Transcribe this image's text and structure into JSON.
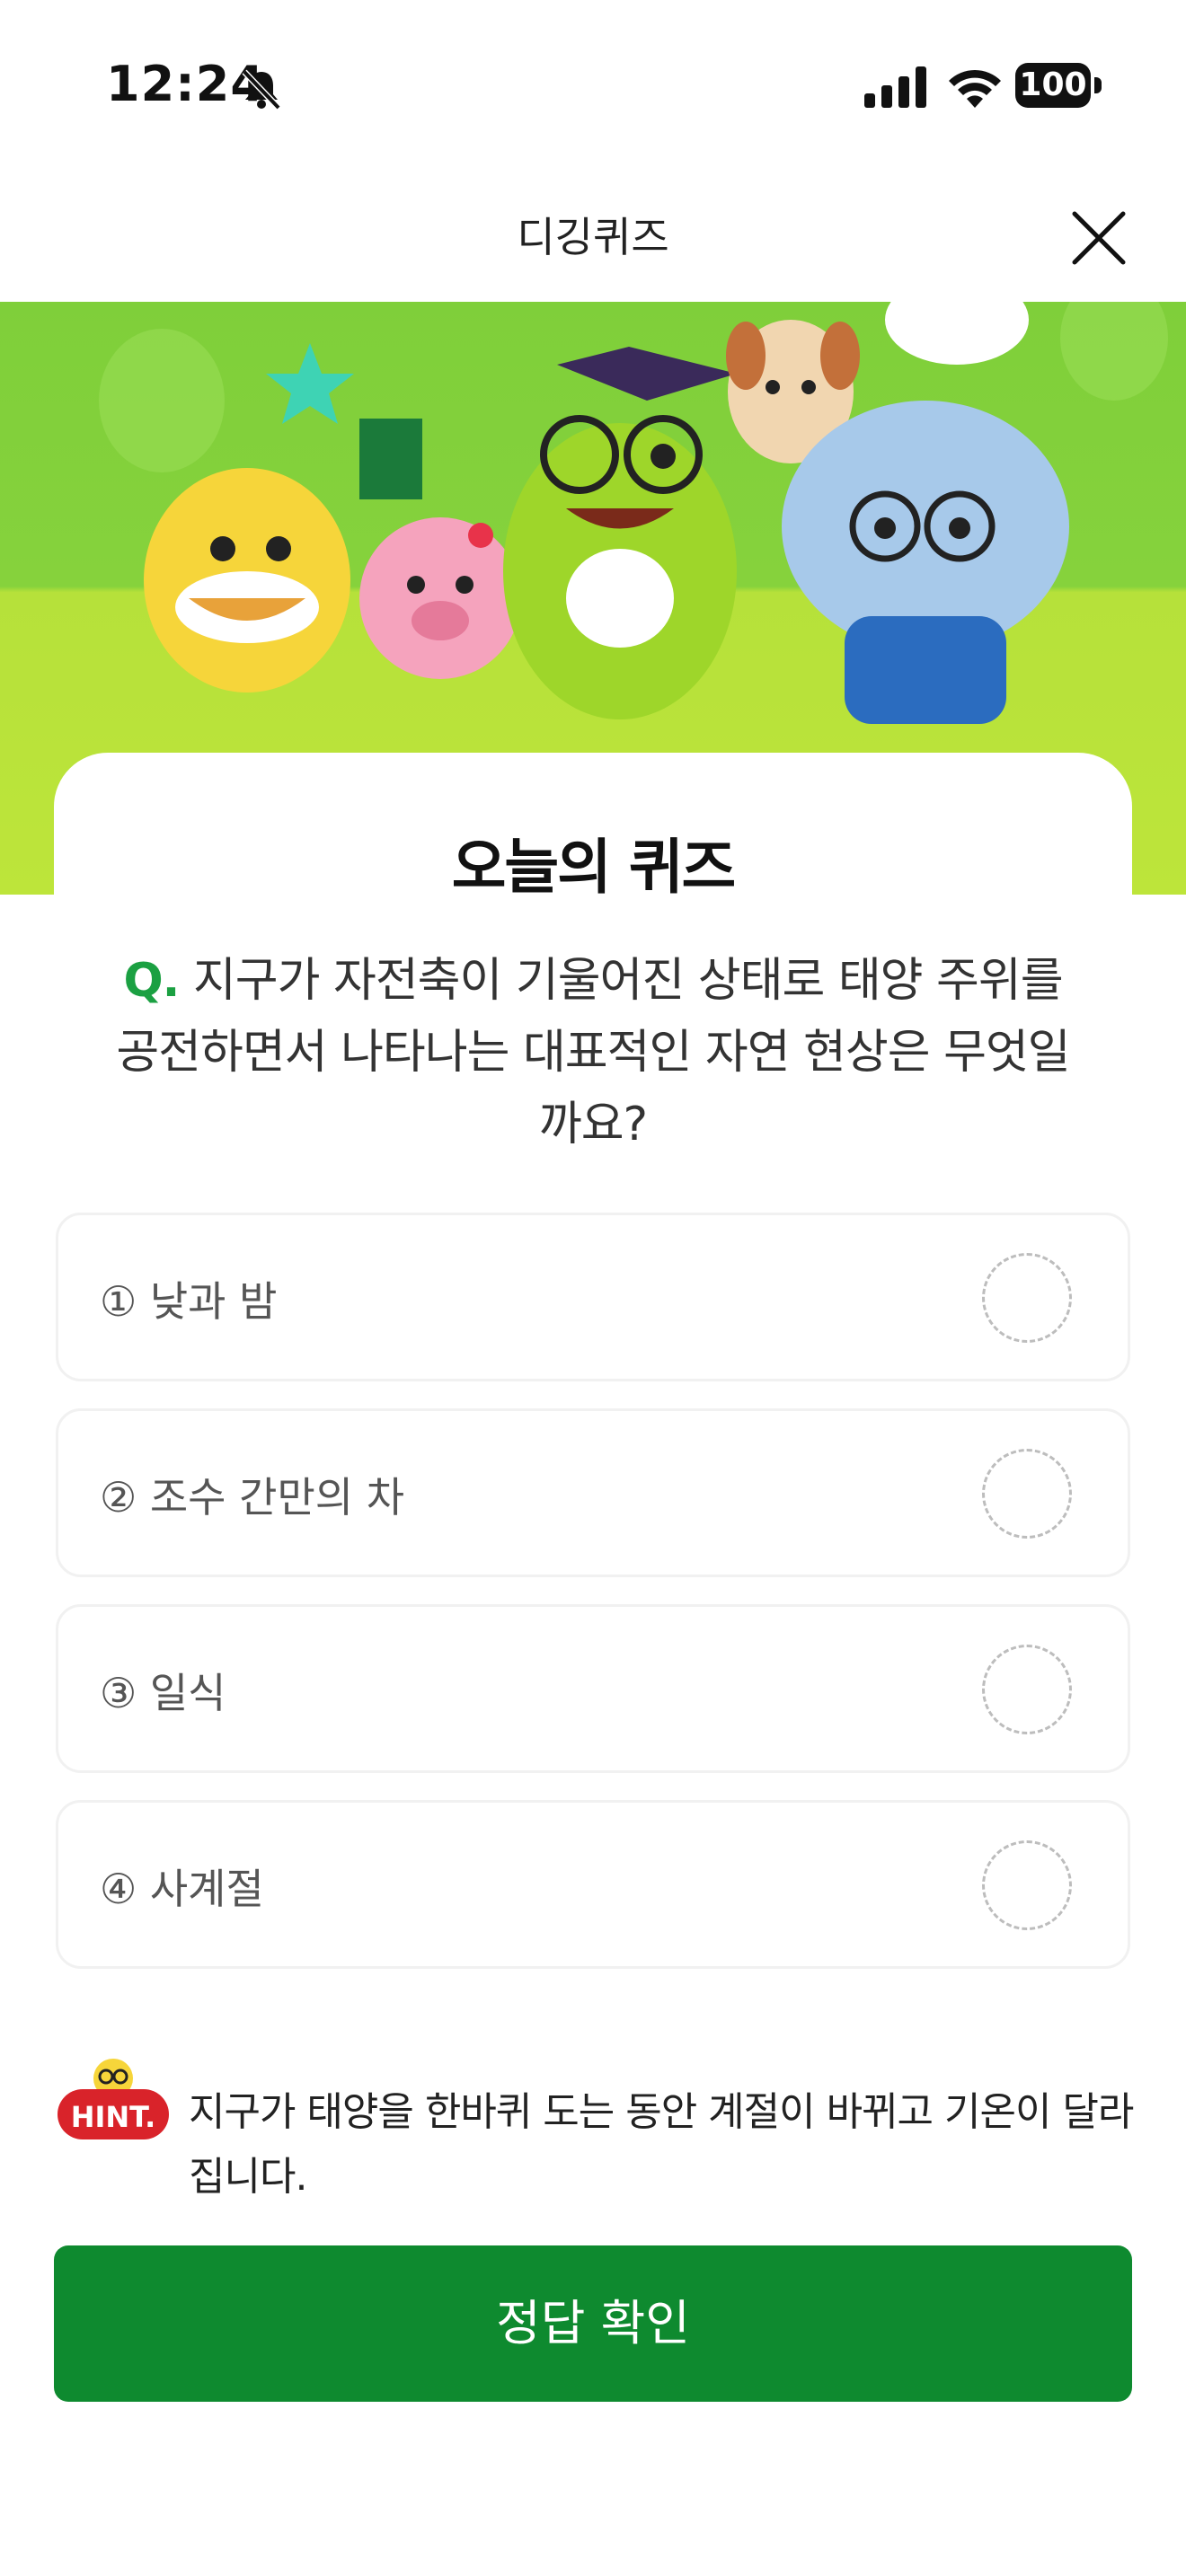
{
  "status_bar": {
    "time": "12:24",
    "battery": "100"
  },
  "nav": {
    "title": "디깅퀴즈"
  },
  "quiz": {
    "heading": "오늘의 퀴즈",
    "question_prefix": "Q.",
    "question": "지구가 자전축이 기울어진 상태로 태양 주위를 공전하면서 나타나는 대표적인 자연 현상은 무엇일까요?",
    "options": [
      {
        "label": "① 낮과 밤"
      },
      {
        "label": "② 조수 간만의 차"
      },
      {
        "label": "③ 일식"
      },
      {
        "label": "④ 사계절"
      }
    ],
    "hint_badge": "HINT.",
    "hint": "지구가 태양을 한바퀴 도는 동안 계절이 바뀌고 기온이 달라집니다.",
    "submit_label": "정답 확인"
  },
  "colors": {
    "accent_green": "#0e8a2f",
    "banner_green": "#86d23c",
    "hint_red": "#d9232a"
  }
}
